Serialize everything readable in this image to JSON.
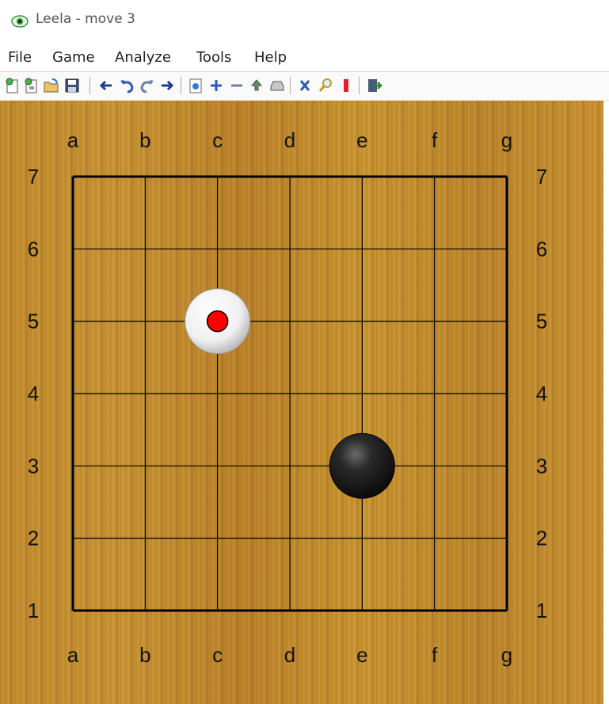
{
  "window": {
    "title": "Leela - move 3"
  },
  "menu": [
    "File",
    "Game",
    "Analyze",
    "Tools",
    "Help"
  ],
  "toolbar": {
    "buttons": [
      "new-game-icon",
      "new-custom-game-icon",
      "open-file-icon",
      "save-file-icon",
      "back-arrow-icon",
      "undo-icon",
      "redo-icon",
      "forward-arrow-icon",
      "settings-icon",
      "plus-icon",
      "minus-icon",
      "upload-icon",
      "print-icon",
      "cross-icon",
      "magnifier-icon",
      "bookmark-icon",
      "exit-icon"
    ]
  },
  "board": {
    "size": 7,
    "columns": [
      "a",
      "b",
      "c",
      "d",
      "e",
      "f",
      "g"
    ],
    "rows": [
      "7",
      "6",
      "5",
      "4",
      "3",
      "2",
      "1"
    ],
    "stones": [
      {
        "color": "white",
        "point": "c5",
        "last_move": true
      },
      {
        "color": "black",
        "point": "e3",
        "last_move": false
      }
    ],
    "colors": {
      "wood": "#c48d2f",
      "line": "#000000",
      "last_move_marker": "#ff0000"
    }
  }
}
